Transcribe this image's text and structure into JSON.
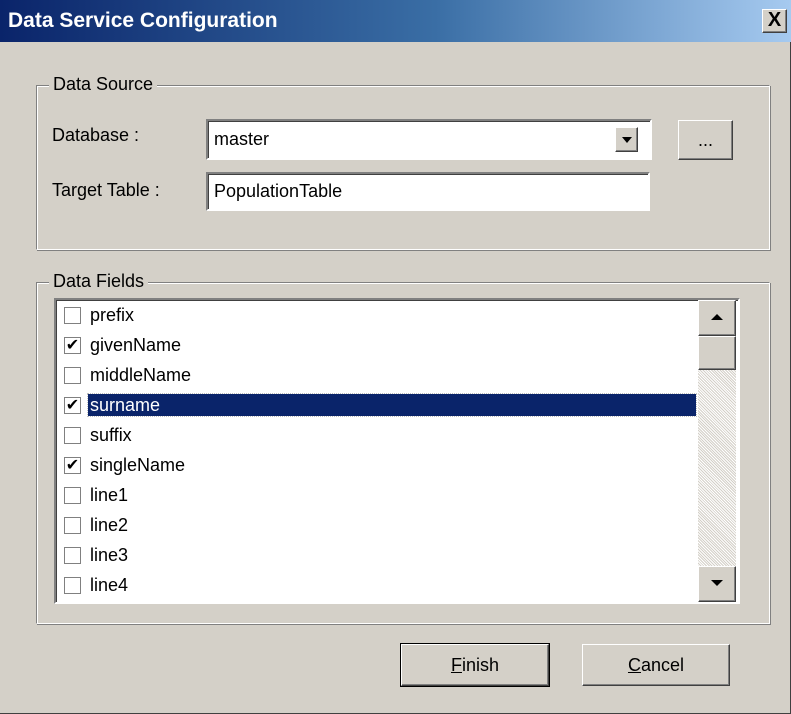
{
  "window": {
    "title": "Data Service Configuration",
    "close_label": "X"
  },
  "data_source": {
    "legend": "Data Source",
    "database_label": "Database :",
    "database_value": "master",
    "browse_label": "...",
    "target_table_label": "Target Table :",
    "target_table_value": "PopulationTable"
  },
  "data_fields": {
    "legend": "Data Fields",
    "items": [
      {
        "label": "prefix",
        "checked": false,
        "selected": false
      },
      {
        "label": "givenName",
        "checked": true,
        "selected": false
      },
      {
        "label": "middleName",
        "checked": false,
        "selected": false
      },
      {
        "label": "surname",
        "checked": true,
        "selected": true
      },
      {
        "label": "suffix",
        "checked": false,
        "selected": false
      },
      {
        "label": "singleName",
        "checked": true,
        "selected": false
      },
      {
        "label": "line1",
        "checked": false,
        "selected": false
      },
      {
        "label": "line2",
        "checked": false,
        "selected": false
      },
      {
        "label": "line3",
        "checked": false,
        "selected": false
      },
      {
        "label": "line4",
        "checked": false,
        "selected": false
      }
    ]
  },
  "buttons": {
    "finish_mnemonic": "F",
    "finish_rest": "inish",
    "cancel_mnemonic": "C",
    "cancel_rest": "ancel"
  },
  "icons": {
    "close": "close-icon",
    "dropdown": "chevron-down-icon",
    "scroll_up": "arrow-up-icon",
    "scroll_down": "arrow-down-icon",
    "check": "checkmark-icon"
  },
  "colors": {
    "title_start": "#0a246a",
    "title_end": "#a6caf0",
    "face": "#d4d0c8",
    "selection": "#0a246a"
  }
}
